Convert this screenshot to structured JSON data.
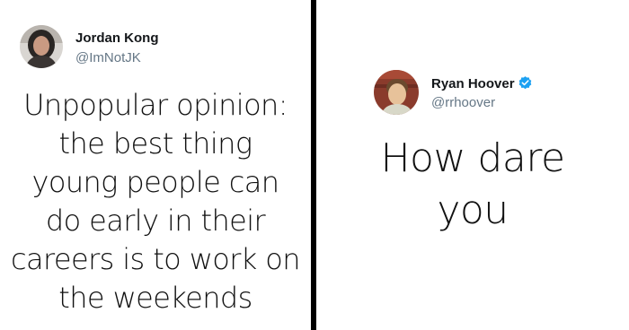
{
  "left_tweet": {
    "author": {
      "name": "Jordan Kong",
      "handle": "@ImNotJK"
    },
    "text_lines": [
      "Unpopular opinion:",
      "the best thing",
      "young people can",
      "do early in their",
      "careers is to work on",
      "the weekends"
    ]
  },
  "right_tweet": {
    "author": {
      "name": "Ryan Hoover",
      "handle": "@rrhoover",
      "verified": true
    },
    "text_lines": [
      "How dare",
      "you"
    ]
  },
  "colors": {
    "divider": "#000000",
    "handle": "#657786",
    "verified": "#1da1f2"
  }
}
